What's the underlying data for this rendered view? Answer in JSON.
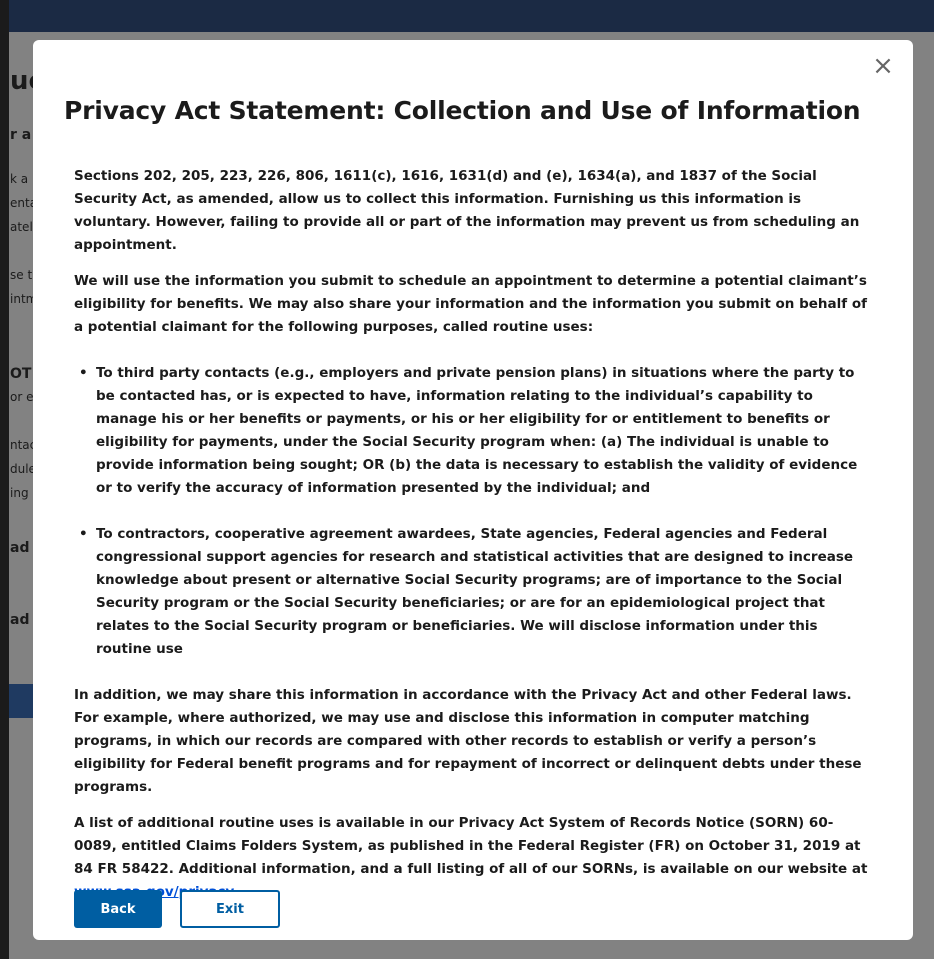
{
  "background": {
    "fragments": [
      "ue",
      "r a",
      "k a",
      "enta",
      "atel",
      "se t",
      "intm",
      "OT a",
      "or e",
      "ntac",
      "dule",
      "ing",
      "ad a",
      "ad a"
    ]
  },
  "modal": {
    "close_glyph": "×",
    "title": "Privacy Act Statement: Collection and Use of Information",
    "paragraph1": "Sections 202, 205, 223, 226, 806, 1611(c), 1616, 1631(d) and (e), 1634(a), and 1837 of the Social Security Act, as amended, allow us to collect this information.  Furnishing us this information is voluntary.  However, failing to provide all or part of the information may prevent us from scheduling an appointment.",
    "paragraph2": "We will use the information you submit to schedule an appointment to determine a potential claimant’s eligibility for benefits.  We may also share your information and the information you submit on behalf of a potential claimant for the following purposes, called routine uses:",
    "bullets": [
      "To third party contacts (e.g., employers and private pension plans) in situations where the party to be contacted has, or is expected to have, information relating to the individual’s capability to manage his or her benefits or payments, or his or her eligibility for or entitlement to benefits or eligibility for payments, under the Social Security program when: (a) The individual is unable to provide information being sought; OR (b) the data is necessary to establish the validity of evidence or to verify the accuracy of information presented by the individual; and",
      "To contractors, cooperative agreement awardees, State agencies, Federal agencies and Federal congressional support agencies for research and statistical activities that are designed to increase knowledge about present or alternative Social Security programs; are of importance to the Social Security program or the Social Security beneficiaries; or are for an epidemiological project that relates to the Social Security program or beneficiaries. We will disclose information under this routine use"
    ],
    "paragraph3": "In addition, we may share this information in accordance with the Privacy Act and other Federal laws.  For example, where authorized, we may use and disclose this information in computer matching programs, in which our records are compared with other records to establish or verify a person’s eligibility for Federal benefit programs and for repayment of incorrect or delinquent debts under these programs.",
    "paragraph4_text": "A list of additional routine uses is available in our Privacy Act System of Records Notice (SORN) 60-0089, entitled Claims Folders System, as published in the Federal Register (FR) on October 31, 2019 at 84 FR 58422. Additional information, and a full listing of all of our SORNs, is available on our website at ",
    "paragraph4_link": "www.ssa.gov/privacy",
    "paragraph4_end": ".",
    "back_label": "Back",
    "exit_label": "Exit"
  },
  "colors": {
    "primary_button": "#005ea2",
    "link": "#0050d8",
    "top_bar": "#1b2a44",
    "overlay": "#808080"
  }
}
